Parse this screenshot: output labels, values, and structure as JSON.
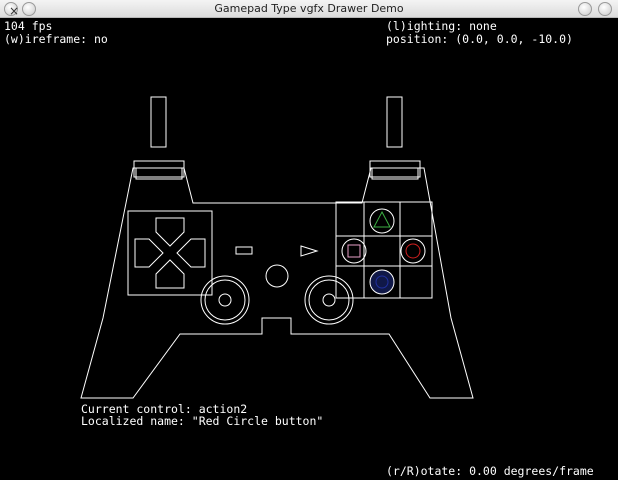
{
  "window": {
    "title": "Gamepad Type vgfx Drawer Demo"
  },
  "hud": {
    "fps": "104 fps",
    "wireframe": "(w)ireframe: no",
    "lighting": "(l)ighting: none",
    "position": "position: (0.0, 0.0, -10.0)",
    "current_control": "Current control: action2",
    "localized_name": "Localized name: \"Red Circle button\"",
    "rotate": "(r/R)otate: 0.00 degrees/frame"
  },
  "colors": {
    "outline": "#ffffff",
    "triangle": "#3cb043",
    "square": "#e8a0c8",
    "circle": "#d02020",
    "cross": "#2030a0"
  },
  "icons": [
    "close-icon",
    "minimize-icon"
  ]
}
